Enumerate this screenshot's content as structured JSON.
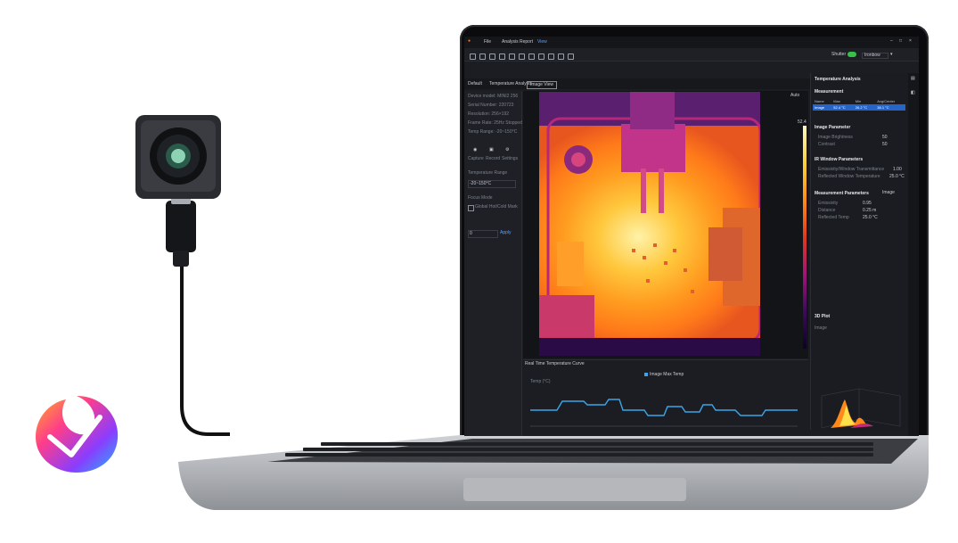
{
  "menu": {
    "items": [
      "File",
      "Analysis",
      "Report",
      "View"
    ]
  },
  "toolbar": {
    "mode_label": "Shutter",
    "palette_value": "Ironbow"
  },
  "tabs": [
    {
      "label": "Default"
    },
    {
      "label": "Temperature Analysis"
    },
    {
      "label": "Image View"
    }
  ],
  "left_panel": {
    "info_lines": [
      "Device model: MINI2 256",
      "Serial Number: 220723",
      "Resolution: 256×192",
      "Frame Rate: 25Hz Stopped",
      "Temp Range: -20~150°C"
    ],
    "action_buttons": [
      "Capture",
      "Record",
      "Settings"
    ],
    "range_label": "Temperature Range",
    "range_value": "-20~150°C",
    "focus_label": "Focus Mode",
    "checkbox_label": "Global Hot/Cold Mark",
    "input_value": "0",
    "apply_label": "Apply"
  },
  "right_panel": {
    "title": "Temperature Analysis",
    "measurement_header": "Measurement",
    "table_headers": [
      "Name",
      "Max",
      "Min",
      "Avg/Center"
    ],
    "table_row": [
      "Image",
      "52.4 °C",
      "26.2 °C",
      "38.1 °C"
    ],
    "image_params_header": "Image Parameter",
    "image_params": [
      {
        "label": "Image Brightness",
        "value": "50"
      },
      {
        "label": "Contrast",
        "value": "50"
      }
    ],
    "ir_window_header": "IR Window Parameters",
    "ir_window": [
      {
        "label": "Emissivity/Window Transmittance",
        "value": "1.00"
      },
      {
        "label": "Reflected Window Temperature",
        "value": "25.0 °C"
      }
    ],
    "meas_params_header": "Measurement Parameters",
    "meas_params_scope": "Image",
    "meas_params": [
      {
        "label": "Emissivity",
        "value": "0.95"
      },
      {
        "label": "Distance",
        "value": "0.25 m"
      },
      {
        "label": "Reflected Temp",
        "value": "25.0 °C"
      }
    ],
    "plot3d_header": "3D Plot",
    "plot3d_sub": "Image"
  },
  "view": {
    "scale_label": "Auto",
    "scale_max": "52.4",
    "chart_title": "Real Time Temperature Curve",
    "legend_label": "Image Max Temp",
    "chart_ylabel": "Temp (°C)"
  },
  "colors": {
    "accent": "#2565c9",
    "toggle_on": "#37c14a",
    "curve": "#3aa6e8"
  },
  "icons": {
    "logo": "flame-logo-icon",
    "usb_camera": "thermal-camera-icon"
  }
}
